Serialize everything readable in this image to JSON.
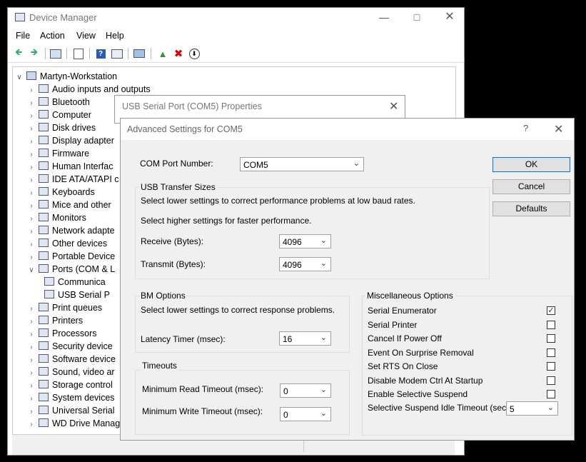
{
  "device_manager": {
    "title": "Device Manager",
    "menus": [
      "File",
      "Action",
      "View",
      "Help"
    ],
    "tree_root": "Martyn-Workstation",
    "tree_items": [
      {
        "label": "Audio inputs and outputs",
        "expanded": false
      },
      {
        "label": "Bluetooth",
        "expanded": false
      },
      {
        "label": "Computer",
        "expanded": false
      },
      {
        "label": "Disk drives",
        "expanded": false
      },
      {
        "label": "Display adapter",
        "expanded": false
      },
      {
        "label": "Firmware",
        "expanded": false
      },
      {
        "label": "Human Interfac",
        "expanded": false
      },
      {
        "label": "IDE ATA/ATAPI c",
        "expanded": false
      },
      {
        "label": "Keyboards",
        "expanded": false
      },
      {
        "label": "Mice and other",
        "expanded": false
      },
      {
        "label": "Monitors",
        "expanded": false
      },
      {
        "label": "Network adapte",
        "expanded": false
      },
      {
        "label": "Other devices",
        "expanded": false
      },
      {
        "label": "Portable Device",
        "expanded": false
      },
      {
        "label": "Ports (COM & L",
        "expanded": true
      },
      {
        "label": "Communica",
        "child": true
      },
      {
        "label": "USB Serial P",
        "child": true
      },
      {
        "label": "Print queues",
        "expanded": false
      },
      {
        "label": "Printers",
        "expanded": false
      },
      {
        "label": "Processors",
        "expanded": false
      },
      {
        "label": "Security device",
        "expanded": false
      },
      {
        "label": "Software device",
        "expanded": false
      },
      {
        "label": "Sound, video ar",
        "expanded": false
      },
      {
        "label": "Storage control",
        "expanded": false
      },
      {
        "label": "System devices",
        "expanded": false
      },
      {
        "label": "Universal Serial",
        "expanded": false
      },
      {
        "label": "WD Drive Manag",
        "expanded": false
      }
    ]
  },
  "properties_dialog": {
    "title": "USB Serial Port (COM5) Properties"
  },
  "advanced_dialog": {
    "title": "Advanced Settings for COM5",
    "help_glyph": "?",
    "com_port_label": "COM Port Number:",
    "com_port_value": "COM5",
    "usb_group": {
      "title": "USB Transfer Sizes",
      "hint_low": "Select lower settings to correct performance problems at low baud rates.",
      "hint_high": "Select higher settings for faster performance.",
      "receive_label": "Receive (Bytes):",
      "receive_value": "4096",
      "transmit_label": "Transmit (Bytes):",
      "transmit_value": "4096"
    },
    "bm_group": {
      "title": "BM Options",
      "hint": "Select lower settings to correct response problems.",
      "latency_label": "Latency Timer (msec):",
      "latency_value": "16"
    },
    "timeouts_group": {
      "title": "Timeouts",
      "read_label": "Minimum Read Timeout (msec):",
      "read_value": "0",
      "write_label": "Minimum Write Timeout (msec):",
      "write_value": "0"
    },
    "misc_group": {
      "title": "Miscellaneous Options",
      "options": [
        {
          "label": "Serial Enumerator",
          "checked": true
        },
        {
          "label": "Serial Printer",
          "checked": false
        },
        {
          "label": "Cancel If Power Off",
          "checked": false
        },
        {
          "label": "Event On Surprise Removal",
          "checked": false
        },
        {
          "label": "Set RTS On Close",
          "checked": false
        },
        {
          "label": "Disable Modem Ctrl At Startup",
          "checked": false
        },
        {
          "label": "Enable Selective Suspend",
          "checked": false
        }
      ],
      "suspend_label": "Selective Suspend Idle Timeout (secs):",
      "suspend_value": "5"
    },
    "buttons": {
      "ok": "OK",
      "cancel": "Cancel",
      "defaults": "Defaults"
    }
  },
  "colors": {
    "accent": "#0078d7",
    "dialog_bg": "#f0f0f0"
  }
}
